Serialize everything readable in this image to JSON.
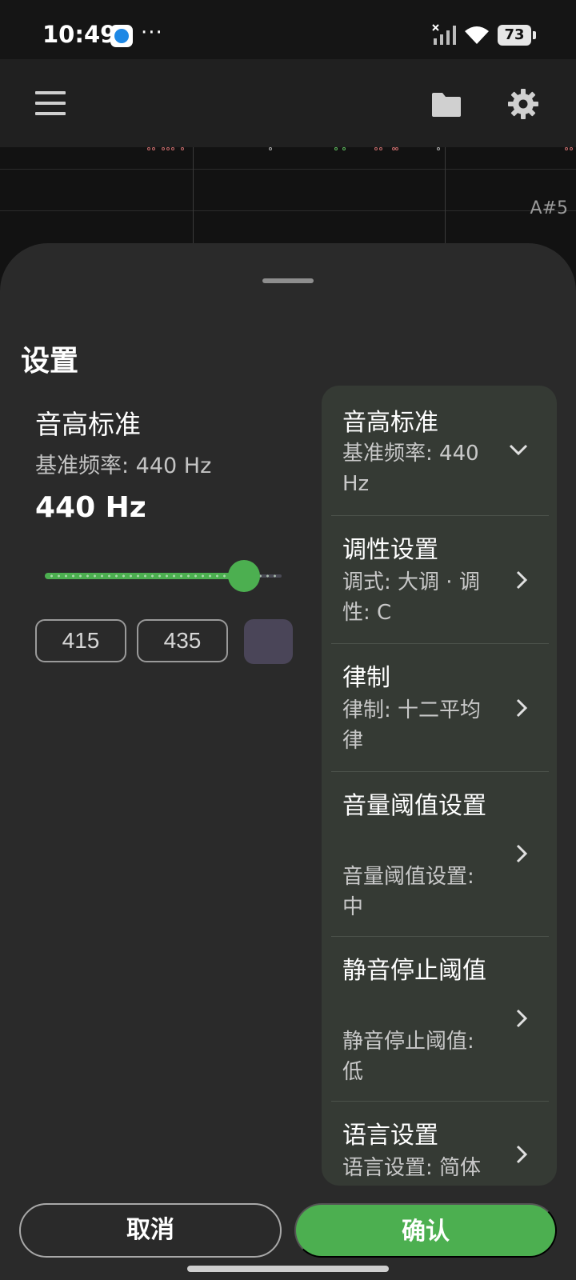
{
  "status_bar": {
    "time": "10:49",
    "more": "···",
    "battery": "73"
  },
  "app_bar": {
    "menu_icon": "hamburger-icon",
    "folder_icon": "folder-icon",
    "settings_icon": "gear-icon"
  },
  "background": {
    "note_label": "A#5"
  },
  "sheet": {
    "title": "设置",
    "detail": {
      "heading": "音高标准",
      "subtitle": "基准频率: 440 Hz",
      "value": "440 Hz",
      "slider_fraction": 0.84,
      "presets": [
        "415",
        "435"
      ]
    },
    "items": [
      {
        "title": "音高标准",
        "subtitle": "基准频率: 440 Hz",
        "icon": "chevron-down-icon"
      },
      {
        "title": "调性设置",
        "subtitle": "调式: 大调 · 调性: C",
        "icon": "chevron-right-icon"
      },
      {
        "title": "律制",
        "subtitle": "律制: 十二平均律",
        "icon": "chevron-right-icon"
      },
      {
        "title": "音量阈值设置",
        "subtitle": "音量阈值设置: 中",
        "icon": "chevron-right-icon"
      },
      {
        "title": "静音停止阈值",
        "subtitle": "静音停止阈值: 低",
        "icon": "chevron-right-icon"
      },
      {
        "title": "语言设置",
        "subtitle": "语言设置: 简体",
        "icon": "chevron-right-icon"
      }
    ]
  },
  "buttons": {
    "cancel": "取消",
    "confirm": "确认"
  },
  "colors": {
    "accent": "#4caf50",
    "sheet_bg": "#2a2a2a",
    "card_bg": "#353a34"
  }
}
